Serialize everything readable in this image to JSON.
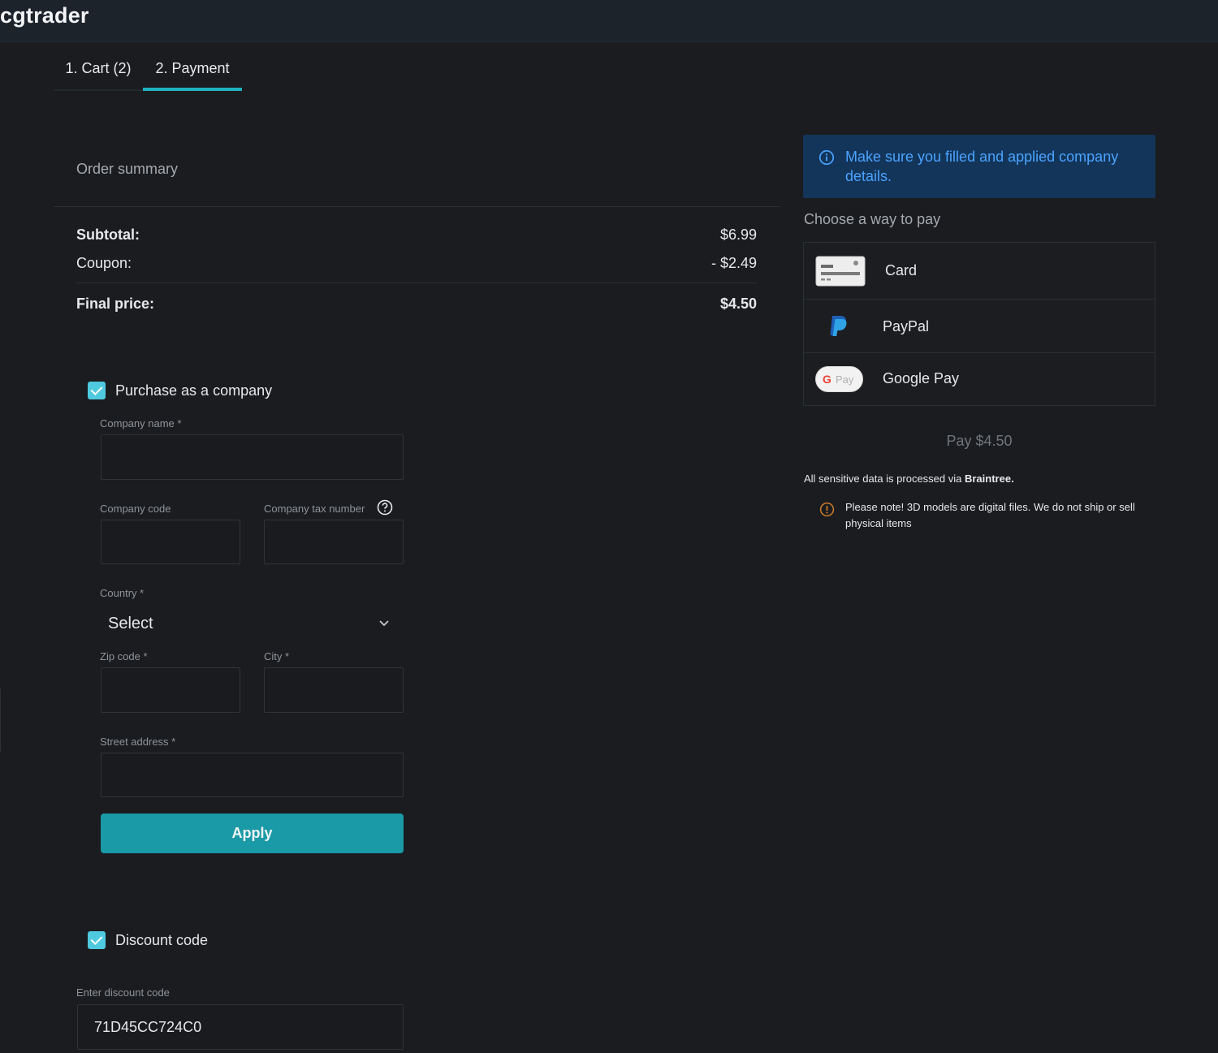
{
  "header": {
    "brand": "cgtrader"
  },
  "tabs": [
    {
      "label": "1. Cart (2)"
    },
    {
      "label": "2. Payment"
    }
  ],
  "order": {
    "title": "Order summary",
    "subtotal_label": "Subtotal:",
    "subtotal_value": "$6.99",
    "coupon_label": "Coupon:",
    "coupon_value": "- $2.49",
    "final_label": "Final price:",
    "final_value": "$4.50"
  },
  "company": {
    "checkbox_label": "Purchase as a company",
    "checked": true,
    "name_label": "Company name *",
    "name_value": "",
    "code_label": "Company code",
    "code_value": "",
    "tax_label": "Company tax number",
    "tax_value": "",
    "country_label": "Country *",
    "country_selected": "Select",
    "zip_label": "Zip code *",
    "zip_value": "",
    "city_label": "City *",
    "city_value": "",
    "street_label": "Street address *",
    "street_value": "",
    "apply_label": "Apply"
  },
  "discount": {
    "checkbox_label": "Discount code",
    "checked": true,
    "field_label": "Enter discount code",
    "field_value": "71D45CC724C0"
  },
  "payment": {
    "info": "Make sure you filled and applied company details.",
    "choose_title": "Choose a way to pay",
    "methods": [
      {
        "label": "Card",
        "icon": "credit-card-icon"
      },
      {
        "label": "PayPal",
        "icon": "paypal-icon"
      },
      {
        "label": "Google Pay",
        "icon": "google-pay-icon"
      }
    ],
    "gpay_badge": "Pay",
    "pay_button": "Pay $4.50",
    "sensitive_prefix": "All sensitive data is processed via ",
    "sensitive_brand": "Braintree.",
    "note": "Please note! 3D models are digital files. We do not ship or sell physical items"
  },
  "colors": {
    "accent": "#1fb1bf",
    "button": "#1a99a6",
    "checkbox": "#4fc9df",
    "info_bg": "#13355a",
    "info_text": "#4aa3ff",
    "warning": "#c97a2c"
  }
}
